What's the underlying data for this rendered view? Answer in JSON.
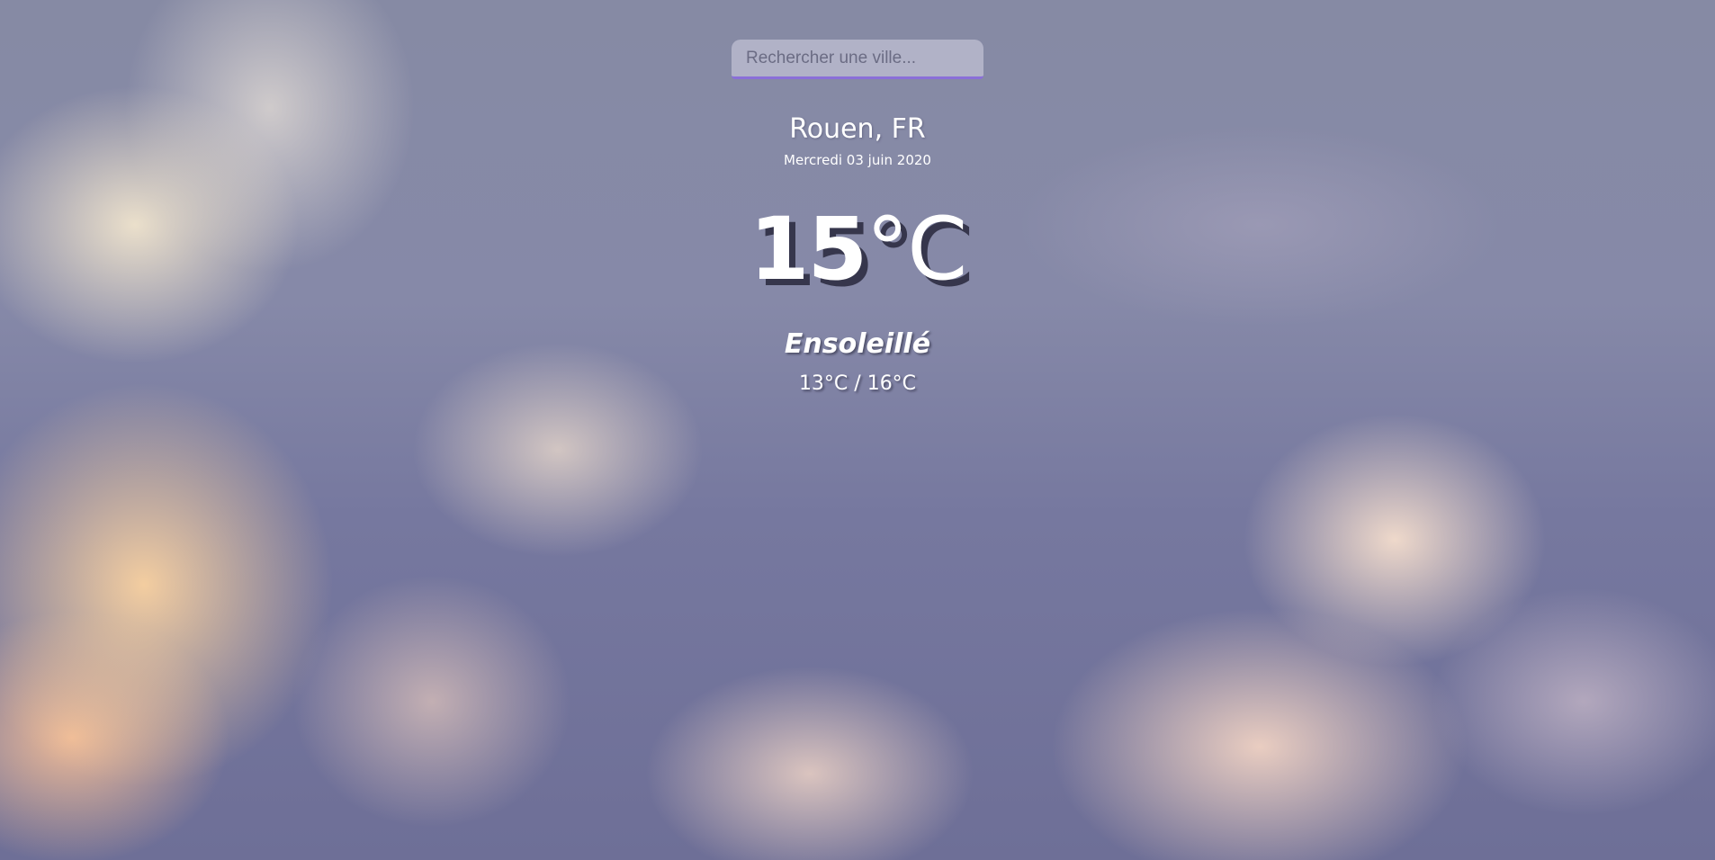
{
  "search": {
    "placeholder": "Rechercher une ville...",
    "value": ""
  },
  "location": {
    "city": "Rouen, FR",
    "date": "Mercredi 03 juin 2020"
  },
  "weather": {
    "temperature_value": "15",
    "temperature_unit": "°C",
    "description": "Ensoleillé",
    "min_max": "13°C / 16°C"
  },
  "colors": {
    "search_underline": "#8a6fd8",
    "text": "#ffffff"
  }
}
